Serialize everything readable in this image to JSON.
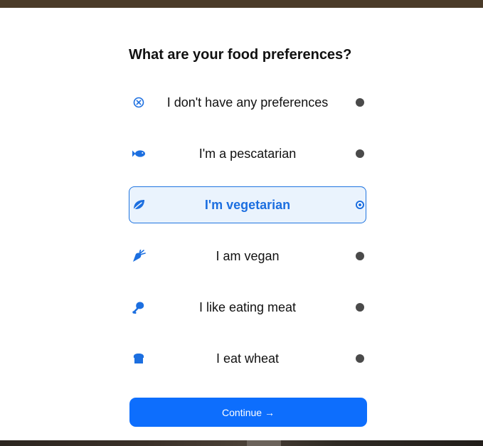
{
  "title": "What are your food preferences?",
  "accent_color": "#0d6efd",
  "options": [
    {
      "label": "I don't have any preferences",
      "icon": "circle-x-icon",
      "selected": false
    },
    {
      "label": "I'm a pescatarian",
      "icon": "fish-icon",
      "selected": false
    },
    {
      "label": "I'm vegetarian",
      "icon": "leaf-icon",
      "selected": true
    },
    {
      "label": "I am vegan",
      "icon": "carrot-icon",
      "selected": false
    },
    {
      "label": "I like eating meat",
      "icon": "drumstick-icon",
      "selected": false
    },
    {
      "label": "I eat wheat",
      "icon": "bread-icon",
      "selected": false
    }
  ],
  "continue_label": "Continue →"
}
